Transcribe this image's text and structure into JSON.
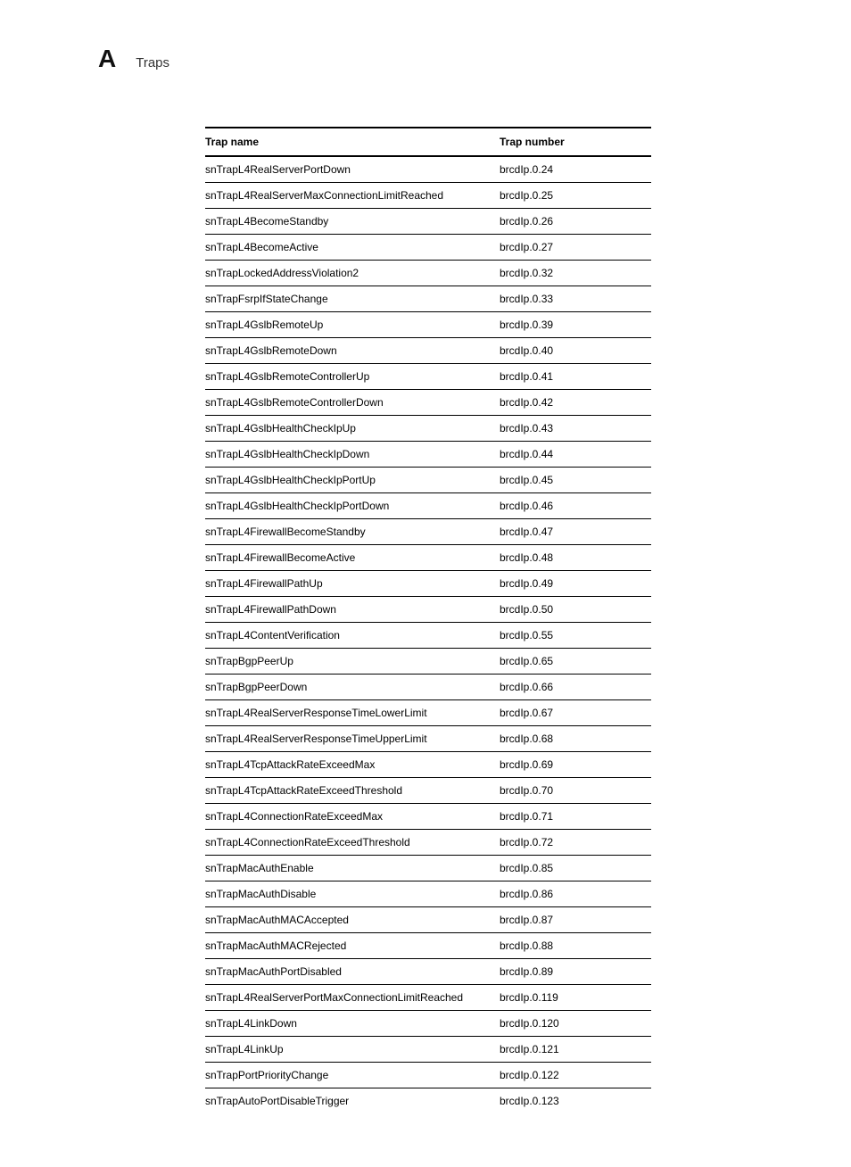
{
  "header": {
    "appendix_letter": "A",
    "title": "Traps"
  },
  "table": {
    "columns": {
      "name": "Trap name",
      "number": "Trap number"
    },
    "rows": [
      {
        "name": "snTrapL4RealServerPortDown",
        "number": "brcdIp.0.24"
      },
      {
        "name": "snTrapL4RealServerMaxConnectionLimitReached",
        "number": "brcdIp.0.25"
      },
      {
        "name": "snTrapL4BecomeStandby",
        "number": "brcdIp.0.26"
      },
      {
        "name": "snTrapL4BecomeActive",
        "number": "brcdIp.0.27"
      },
      {
        "name": "snTrapLockedAddressViolation2",
        "number": "brcdIp.0.32"
      },
      {
        "name": "snTrapFsrpIfStateChange",
        "number": "brcdIp.0.33"
      },
      {
        "name": "snTrapL4GslbRemoteUp",
        "number": "brcdIp.0.39"
      },
      {
        "name": "snTrapL4GslbRemoteDown",
        "number": "brcdIp.0.40"
      },
      {
        "name": "snTrapL4GslbRemoteControllerUp",
        "number": "brcdIp.0.41"
      },
      {
        "name": "snTrapL4GslbRemoteControllerDown",
        "number": "brcdIp.0.42"
      },
      {
        "name": "snTrapL4GslbHealthCheckIpUp",
        "number": "brcdIp.0.43"
      },
      {
        "name": "snTrapL4GslbHealthCheckIpDown",
        "number": "brcdIp.0.44"
      },
      {
        "name": "snTrapL4GslbHealthCheckIpPortUp",
        "number": "brcdIp.0.45"
      },
      {
        "name": "snTrapL4GslbHealthCheckIpPortDown",
        "number": "brcdIp.0.46"
      },
      {
        "name": "snTrapL4FirewallBecomeStandby",
        "number": "brcdIp.0.47"
      },
      {
        "name": "snTrapL4FirewallBecomeActive",
        "number": "brcdIp.0.48"
      },
      {
        "name": "snTrapL4FirewallPathUp",
        "number": "brcdIp.0.49"
      },
      {
        "name": "snTrapL4FirewallPathDown",
        "number": "brcdIp.0.50"
      },
      {
        "name": "snTrapL4ContentVerification",
        "number": "brcdIp.0.55"
      },
      {
        "name": "snTrapBgpPeerUp",
        "number": "brcdIp.0.65"
      },
      {
        "name": "snTrapBgpPeerDown",
        "number": "brcdIp.0.66"
      },
      {
        "name": "snTrapL4RealServerResponseTimeLowerLimit",
        "number": "brcdIp.0.67"
      },
      {
        "name": "snTrapL4RealServerResponseTimeUpperLimit",
        "number": "brcdIp.0.68"
      },
      {
        "name": "snTrapL4TcpAttackRateExceedMax",
        "number": "brcdIp.0.69"
      },
      {
        "name": "snTrapL4TcpAttackRateExceedThreshold",
        "number": "brcdIp.0.70"
      },
      {
        "name": "snTrapL4ConnectionRateExceedMax",
        "number": "brcdIp.0.71"
      },
      {
        "name": "snTrapL4ConnectionRateExceedThreshold",
        "number": "brcdIp.0.72"
      },
      {
        "name": "snTrapMacAuthEnable",
        "number": "brcdIp.0.85"
      },
      {
        "name": "snTrapMacAuthDisable",
        "number": "brcdIp.0.86"
      },
      {
        "name": "snTrapMacAuthMACAccepted",
        "number": "brcdIp.0.87"
      },
      {
        "name": "snTrapMacAuthMACRejected",
        "number": "brcdIp.0.88"
      },
      {
        "name": "snTrapMacAuthPortDisabled",
        "number": "brcdIp.0.89"
      },
      {
        "name": "snTrapL4RealServerPortMaxConnectionLimitReached",
        "number": "brcdIp.0.119"
      },
      {
        "name": "snTrapL4LinkDown",
        "number": "brcdIp.0.120"
      },
      {
        "name": "snTrapL4LinkUp",
        "number": "brcdIp.0.121"
      },
      {
        "name": "snTrapPortPriorityChange",
        "number": "brcdIp.0.122"
      },
      {
        "name": "snTrapAutoPortDisableTrigger",
        "number": "brcdIp.0.123"
      }
    ]
  }
}
